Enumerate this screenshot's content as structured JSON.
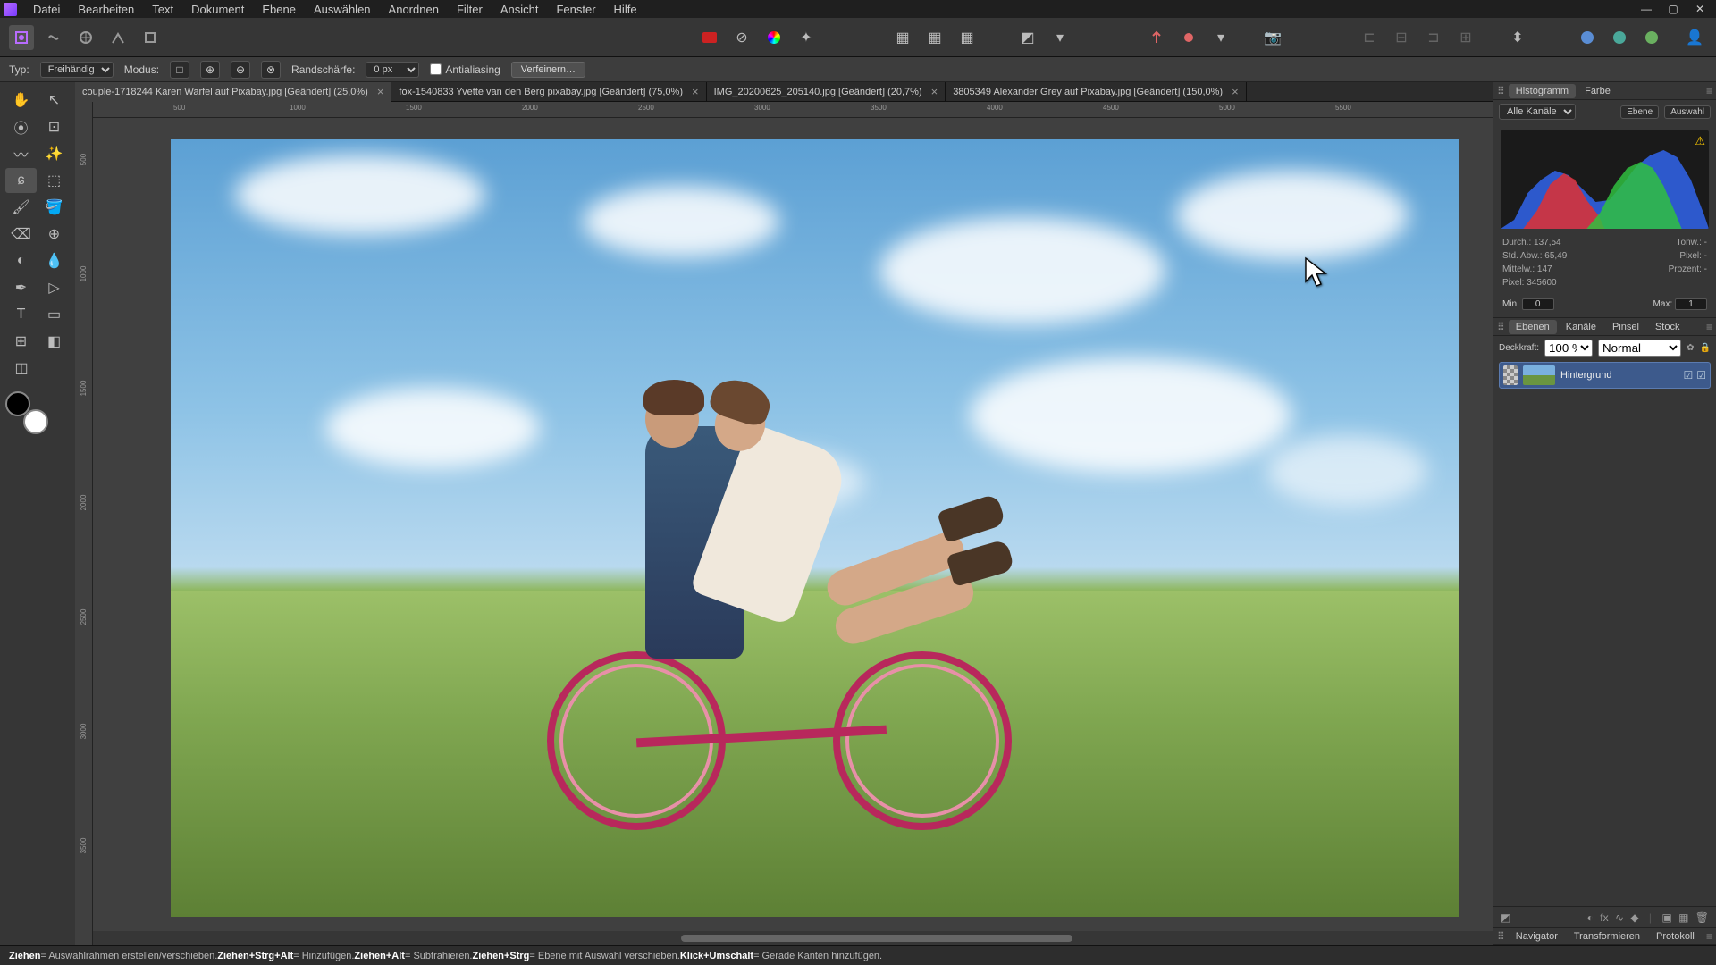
{
  "menu": [
    "Datei",
    "Bearbeiten",
    "Text",
    "Dokument",
    "Ebene",
    "Auswählen",
    "Anordnen",
    "Filter",
    "Ansicht",
    "Fenster",
    "Hilfe"
  ],
  "optbar": {
    "typ_label": "Typ:",
    "typ_value": "Freihändig",
    "modus_label": "Modus:",
    "rand_label": "Randschärfe:",
    "rand_value": "0 px",
    "aa": "Antialiasing",
    "refine": "Verfeinern…"
  },
  "tabs": [
    {
      "label": "couple-1718244 Karen Warfel auf Pixabay.jpg [Geändert] (25,0%)",
      "active": true
    },
    {
      "label": "fox-1540833 Yvette van den Berg pixabay.jpg [Geändert] (75,0%)",
      "active": false
    },
    {
      "label": "IMG_20200625_205140.jpg [Geändert] (20,7%)",
      "active": false
    },
    {
      "label": "3805349 Alexander Grey auf Pixabay.jpg [Geändert] (150,0%)",
      "active": false
    }
  ],
  "ruler_h": [
    "500",
    "1000",
    "1500",
    "2000",
    "2500",
    "3000",
    "3500",
    "4000",
    "4500",
    "5000",
    "5500"
  ],
  "ruler_v": [
    "500",
    "1000",
    "1500",
    "2000",
    "2500",
    "3000",
    "3500"
  ],
  "right": {
    "tabs1": [
      "Histogramm",
      "Farbe"
    ],
    "channels": "Alle Kanäle",
    "ebene": "Ebene",
    "auswahl": "Auswahl",
    "stats": {
      "durch_l": "Durch.:",
      "durch_v": "137,54",
      "std_l": "Std. Abw.:",
      "std_v": "65,49",
      "mittel_l": "Mittelw.:",
      "mittel_v": "147",
      "pixel_l": "Pixel:",
      "pixel_v": "345600",
      "tonw_l": "Tonw.:",
      "tonw_v": "-",
      "pix2_l": "Pixel:",
      "pix2_v": "-",
      "proz_l": "Prozent:",
      "proz_v": "-"
    },
    "min_l": "Min:",
    "min_v": "0",
    "max_l": "Max:",
    "max_v": "1",
    "tabs2": [
      "Ebenen",
      "Kanäle",
      "Pinsel",
      "Stock"
    ],
    "opac_l": "Deckkraft:",
    "opac_v": "100 %",
    "blend": "Normal",
    "layer_name": "Hintergrund",
    "tabs3": [
      "Navigator",
      "Transformieren",
      "Protokoll"
    ]
  },
  "status": {
    "s1": "Ziehen",
    "s1t": " = Auswahlrahmen erstellen/verschieben. ",
    "s2": "Ziehen+Strg+Alt",
    "s2t": " = Hinzufügen. ",
    "s3": "Ziehen+Alt",
    "s3t": " = Subtrahieren. ",
    "s4": "Ziehen+Strg",
    "s4t": " = Ebene mit Auswahl verschieben. ",
    "s5": "Klick+Umschalt",
    "s5t": " = Gerade Kanten hinzufügen."
  }
}
